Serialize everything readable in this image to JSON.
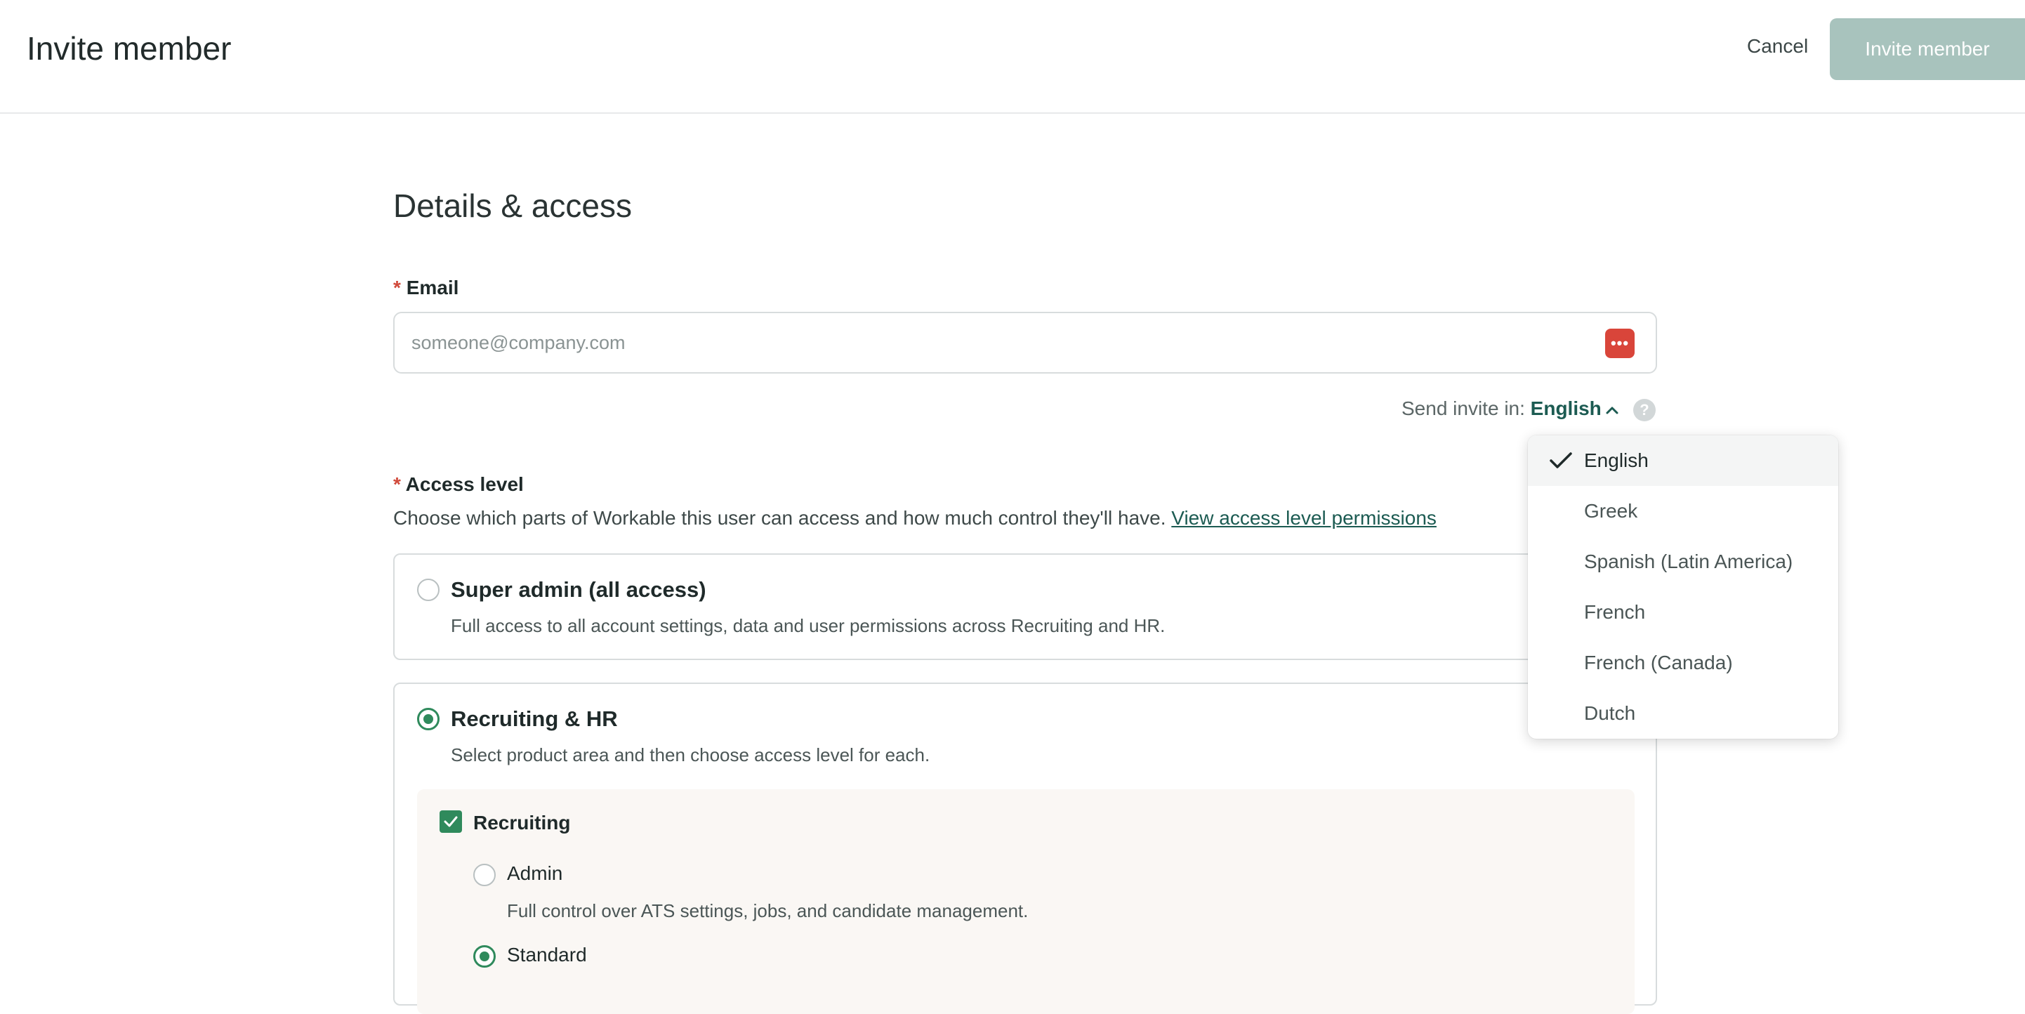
{
  "header": {
    "title": "Invite member",
    "cancel_label": "Cancel",
    "invite_label": "Invite member"
  },
  "form": {
    "section_title": "Details & access",
    "email": {
      "required_mark": "*",
      "label": "Email",
      "placeholder": "someone@company.com",
      "value": "",
      "password_icon": "password-manager-icon"
    },
    "send_invite": {
      "prefix": "Send invite in:",
      "language": "English",
      "help_glyph": "?"
    },
    "access": {
      "required_mark": "*",
      "label": "Access level",
      "description": "Choose which parts of Workable this user can access and how much control they'll have.",
      "link_text": "View access level permissions",
      "options": [
        {
          "title": "Super admin (all access)",
          "description": "Full access to all account settings, data and user permissions across Recruiting and HR.",
          "selected": false
        },
        {
          "title": "Recruiting & HR",
          "description": "Select product area and then choose access level for each.",
          "selected": true
        }
      ],
      "recruiting": {
        "label": "Recruiting",
        "checked": true,
        "roles": [
          {
            "label": "Admin",
            "description": "Full control over ATS settings, jobs, and candidate management.",
            "selected": false
          },
          {
            "label": "Standard",
            "selected": true
          }
        ]
      }
    }
  },
  "language_dropdown": {
    "selected": "English",
    "items": [
      "English",
      "Greek",
      "Spanish (Latin America)",
      "French",
      "French (Canada)",
      "Dutch"
    ]
  },
  "colors": {
    "brand_green": "#2f8a5c",
    "link_teal": "#1c5b52",
    "disabled_button": "#a8c3bd",
    "required_red": "#d14a3b"
  }
}
